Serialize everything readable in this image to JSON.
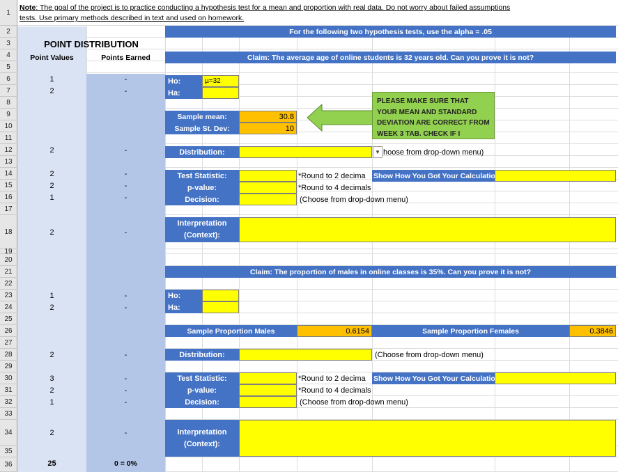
{
  "note": {
    "label": "Note",
    "text": ": The goal of the project is to practice conducting a hypothesis test for a mean and proportion with real data. Do not worry about failed assumptions",
    "line2": "tests. Use primary methods described in text and used on homework."
  },
  "row_numbers": [
    "1",
    "2",
    "3",
    "4",
    "5",
    "6",
    "7",
    "8",
    "9",
    "10",
    "11",
    "12",
    "13",
    "14",
    "15",
    "16",
    "17",
    "18",
    "19",
    "20",
    "21",
    "22",
    "23",
    "24",
    "25",
    "26",
    "27",
    "28",
    "29",
    "30",
    "31",
    "32",
    "33",
    "34",
    "35",
    "36"
  ],
  "alpha_banner": "For the following two hypothesis tests, use the alpha = .05",
  "point_distribution": {
    "title": "POINT DISTRIBUTION",
    "col1": "Point Values",
    "col2": "Points Earned",
    "rows": [
      {
        "value": "1",
        "earned": "-"
      },
      {
        "value": "2",
        "earned": "-"
      },
      {
        "value": "2",
        "earned": "-"
      },
      {
        "value": "2",
        "earned": "-"
      },
      {
        "value": "2",
        "earned": "-"
      },
      {
        "value": "1",
        "earned": "-"
      },
      {
        "value": "2",
        "earned": "-"
      },
      {
        "value": "1",
        "earned": "-"
      },
      {
        "value": "2",
        "earned": "-"
      },
      {
        "value": "2",
        "earned": "-"
      },
      {
        "value": "3",
        "earned": "-"
      },
      {
        "value": "2",
        "earned": "-"
      },
      {
        "value": "1",
        "earned": "-"
      },
      {
        "value": "2",
        "earned": "-"
      }
    ],
    "total_value": "25",
    "total_earned": "0 = 0%"
  },
  "test1": {
    "claim": "Claim: The average age of online students is 32 years old. Can you prove it is not?",
    "ho_label": "Ho:",
    "ho_value": "µ=32",
    "ha_label": "Ha:",
    "ha_value": "",
    "sample_mean_label": "Sample mean:",
    "sample_mean_value": "30.8",
    "sample_sd_label": "Sample St. Dev:",
    "sample_sd_value": "10",
    "callout": "PLEASE MAKE SURE THAT YOUR MEAN AND STANDARD DEVIATION ARE CORRECT FROM WEEK 3 TAB. CHECK IF I",
    "distribution_label": "Distribution:",
    "distribution_hint": "hoose from drop-down menu)",
    "test_stat_label": "Test Statistic:",
    "test_stat_hint": "*Round to 2 decima",
    "show_calc": "Show How You Got Your Calculatio",
    "pvalue_label": "p-value:",
    "pvalue_hint": "*Round to 4 decimals",
    "decision_label": "Decision:",
    "decision_hint": "(Choose from drop-down menu)",
    "interp_label1": "Interpretation",
    "interp_label2": "(Context):"
  },
  "test2": {
    "claim": "Claim: The proportion of males in online classes is 35%. Can you prove it is not?",
    "ho_label": "Ho:",
    "ha_label": "Ha:",
    "sample_males_label": "Sample Proportion Males",
    "sample_males_value": "0.6154",
    "sample_females_label": "Sample Proportion Females",
    "sample_females_value": "0.3846",
    "distribution_label": "Distribution:",
    "distribution_hint": "(Choose from drop-down menu)",
    "test_stat_label": "Test Statistic:",
    "test_stat_hint": "*Round to 2 decima",
    "show_calc": "Show How You Got Your Calculatio",
    "pvalue_label": "p-value:",
    "pvalue_hint": "*Round to 4 decimals",
    "decision_label": "Decision:",
    "decision_hint": "(Choose from drop-down menu)",
    "interp_label1": "Interpretation",
    "interp_label2": "(Context):"
  },
  "colors": {
    "blue": "#4472c4",
    "yellow": "#ffff00",
    "orange": "#ffc000",
    "green": "#92d050",
    "lightblue": "#b4c6e7",
    "paleblue": "#dae3f3"
  },
  "icons": {
    "dropdown": "dropdown-arrow-icon",
    "arrow": "left-arrow-icon"
  }
}
